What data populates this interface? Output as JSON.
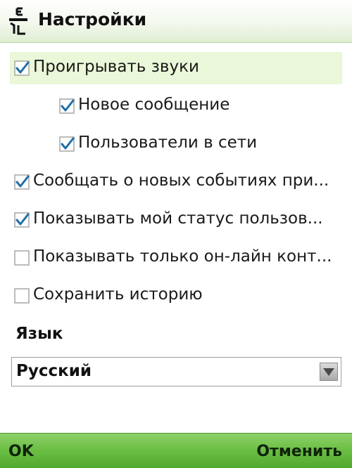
{
  "header": {
    "title": "Настройки",
    "icon": "app-menu-icon"
  },
  "settings": [
    {
      "label": "Проигрывать звуки",
      "checked": true,
      "indent": 0,
      "focused": true
    },
    {
      "label": "Новое сообщение",
      "checked": true,
      "indent": 1,
      "focused": false
    },
    {
      "label": "Пользователи в сети",
      "checked": true,
      "indent": 1,
      "focused": false
    },
    {
      "label": "Сообщать о новых событиях при...",
      "checked": true,
      "indent": 0,
      "focused": false
    },
    {
      "label": "Показывать мой статус пользов...",
      "checked": true,
      "indent": 0,
      "focused": false
    },
    {
      "label": "Показывать только он-лайн конт...",
      "checked": false,
      "indent": 0,
      "focused": false
    },
    {
      "label": "Сохранить историю",
      "checked": false,
      "indent": 0,
      "focused": false
    }
  ],
  "language": {
    "label": "Язык",
    "selected": "Русский"
  },
  "softkeys": {
    "left": "OK",
    "right": "Отменить"
  },
  "colors": {
    "focus_bg": "#eaf7d8",
    "softkey_bar": "#6cbf45",
    "check_mark": "#1f6fa8"
  }
}
